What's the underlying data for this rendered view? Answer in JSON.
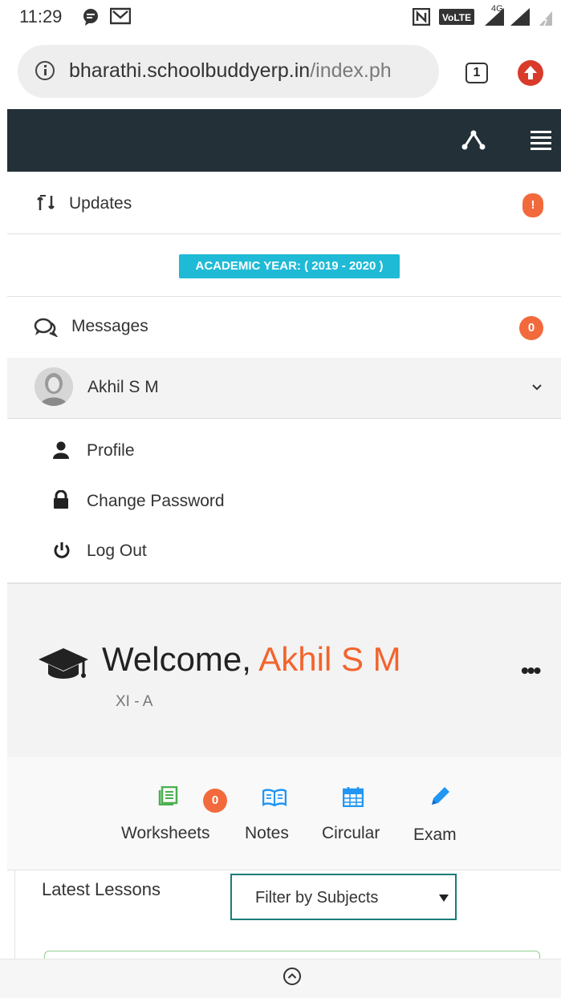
{
  "status_bar": {
    "time": "11:29",
    "network": "4G"
  },
  "browser": {
    "url_host": "bharathi.schoolbuddyerp.in",
    "url_path": "/index.ph",
    "tab_count": "1"
  },
  "updates": {
    "label": "Updates",
    "badge": "!"
  },
  "academic_year": {
    "label": "ACADEMIC YEAR: ( 2019 - 2020 )"
  },
  "messages": {
    "label": "Messages",
    "badge": "0"
  },
  "user": {
    "name": "Akhil S M"
  },
  "user_menu": [
    {
      "label": "Profile",
      "icon": "person-icon"
    },
    {
      "label": "Change Password",
      "icon": "lock-icon"
    },
    {
      "label": "Log Out",
      "icon": "power-icon"
    }
  ],
  "welcome": {
    "greeting": "Welcome, ",
    "name": "Akhil S M",
    "class": "XI - A"
  },
  "tiles": [
    {
      "label": "Worksheets",
      "icon": "worksheet-icon",
      "color": "#4caf50",
      "badge": "0"
    },
    {
      "label": "Notes",
      "icon": "book-icon",
      "color": "#2196f3"
    },
    {
      "label": "Circular",
      "icon": "calendar-icon",
      "color": "#2196f3"
    },
    {
      "label": "Exam",
      "icon": "pencil-icon",
      "color": "#2196f3"
    }
  ],
  "lessons": {
    "title": "Latest Lessons",
    "filter_selected": "Filter by Subjects"
  },
  "colors": {
    "header": "#233038",
    "accent": "#f2642e",
    "academic": "#1fbad6",
    "filter_border": "#1a7c78"
  }
}
